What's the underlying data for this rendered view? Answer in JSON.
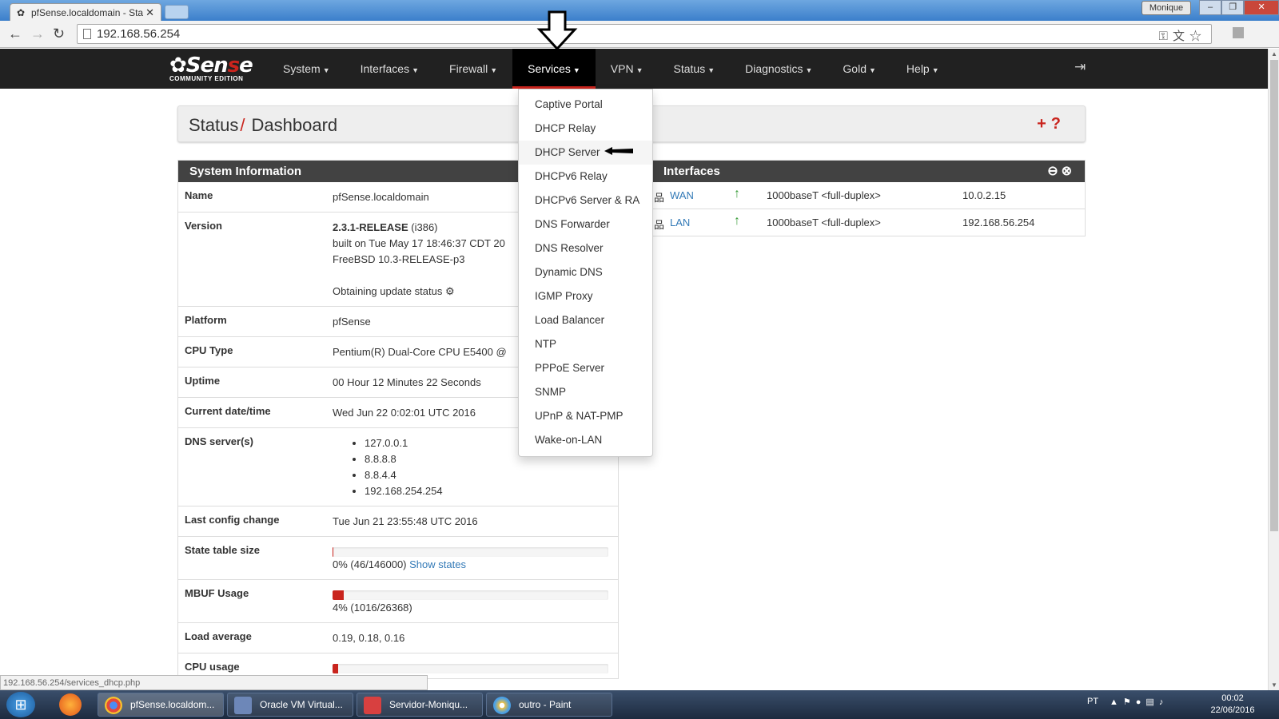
{
  "browser": {
    "tab_title": "pfSense.localdomain - Sta",
    "user_label": "Monique",
    "url": "192.168.56.254",
    "status_url": "192.168.56.254/services_dhcp.php"
  },
  "nav": {
    "logo_text_a": "Sen",
    "logo_text_b": "s",
    "logo_text_c": "e",
    "logo_sub": "COMMUNITY EDITION",
    "items": [
      {
        "label": "System"
      },
      {
        "label": "Interfaces"
      },
      {
        "label": "Firewall"
      },
      {
        "label": "Services"
      },
      {
        "label": "VPN"
      },
      {
        "label": "Status"
      },
      {
        "label": "Diagnostics"
      },
      {
        "label": "Gold"
      },
      {
        "label": "Help"
      }
    ],
    "active_item": "Services"
  },
  "services_menu": [
    "Captive Portal",
    "DHCP Relay",
    "DHCP Server",
    "DHCPv6 Relay",
    "DHCPv6 Server & RA",
    "DNS Forwarder",
    "DNS Resolver",
    "Dynamic DNS",
    "IGMP Proxy",
    "Load Balancer",
    "NTP",
    "PPPoE Server",
    "SNMP",
    "UPnP & NAT-PMP",
    "Wake-on-LAN"
  ],
  "breadcrumb": {
    "section": "Status",
    "page": "Dashboard"
  },
  "system_info": {
    "title": "System Information",
    "name_label": "Name",
    "name_value": "pfSense.localdomain",
    "version_label": "Version",
    "version_release": "2.3.1-RELEASE",
    "version_arch": " (i386)",
    "version_built": "built on Tue May 17 18:46:37 CDT 20",
    "version_os": "FreeBSD 10.3-RELEASE-p3",
    "update_status": "Obtaining update status",
    "platform_label": "Platform",
    "platform_value": "pfSense",
    "cpu_type_label": "CPU Type",
    "cpu_type_value": "Pentium(R) Dual-Core CPU E5400 @",
    "uptime_label": "Uptime",
    "uptime_value": "00 Hour 12 Minutes 22 Seconds",
    "datetime_label": "Current date/time",
    "datetime_value": "Wed Jun 22 0:02:01 UTC 2016",
    "dns_label": "DNS server(s)",
    "dns_servers": [
      "127.0.0.1",
      "8.8.8.8",
      "8.8.4.4",
      "192.168.254.254"
    ],
    "last_config_label": "Last config change",
    "last_config_value": "Tue Jun 21 23:55:48 UTC 2016",
    "state_table_label": "State table size",
    "state_table_value": "0% (46/146000)",
    "state_table_fraction": 0.0003,
    "show_states": "Show states",
    "mbuf_label": "MBUF Usage",
    "mbuf_value": "4% (1016/26368)",
    "mbuf_fraction": 0.04,
    "load_label": "Load average",
    "load_value": "0.19, 0.18, 0.16",
    "cpu_usage_label": "CPU usage",
    "cpu_usage_value": "2%",
    "cpu_usage_fraction": 0.02
  },
  "interfaces": {
    "title": "Interfaces",
    "rows": [
      {
        "name": "WAN",
        "media": "1000baseT <full-duplex>",
        "ip": "10.0.2.15"
      },
      {
        "name": "LAN",
        "media": "1000baseT <full-duplex>",
        "ip": "192.168.56.254"
      }
    ]
  },
  "taskbar": {
    "items": [
      {
        "label": "pfSense.localdom..."
      },
      {
        "label": "Oracle VM Virtual..."
      },
      {
        "label": "Servidor-Moniqu..."
      },
      {
        "label": "outro - Paint"
      }
    ],
    "language": "PT",
    "time": "00:02",
    "date": "22/06/2016"
  },
  "colors": {
    "accent": "#c9241d",
    "navbar": "#212121",
    "panel_head": "#424242",
    "link": "#337ab7",
    "status_up": "#3a9d3a"
  }
}
